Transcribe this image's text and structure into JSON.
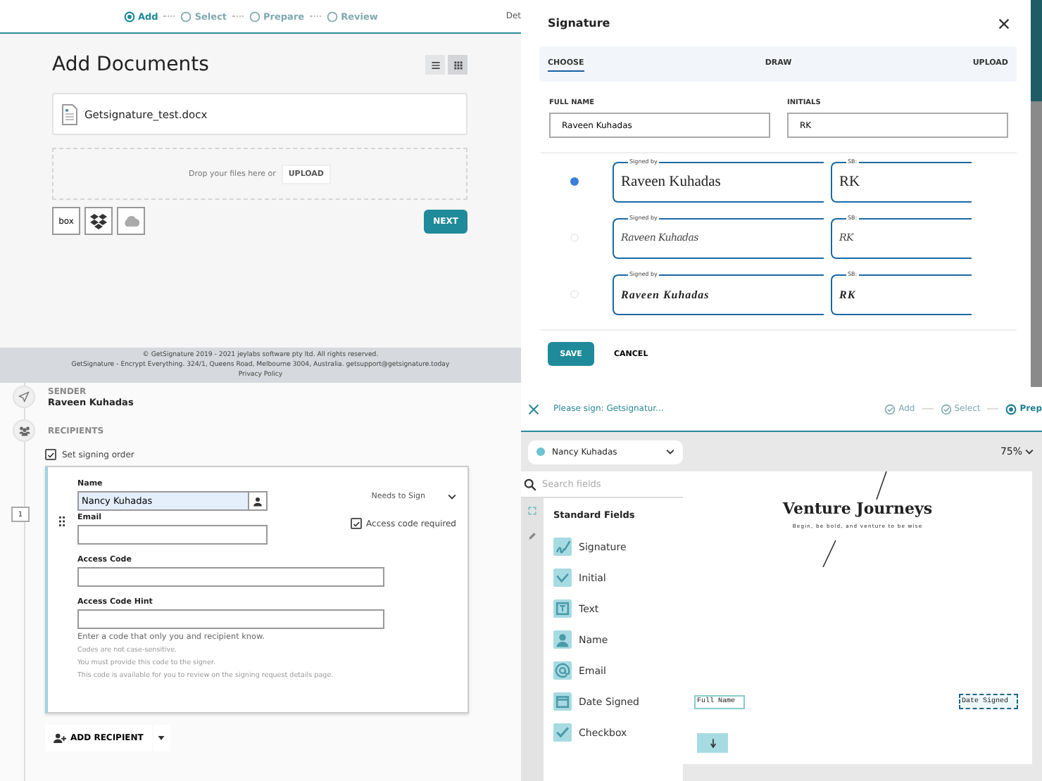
{
  "add_documents": {
    "steps": [
      {
        "label": "Add",
        "selected": true
      },
      {
        "label": "Select",
        "selected": false
      },
      {
        "label": "Prepare",
        "selected": false
      },
      {
        "label": "Review",
        "selected": false
      }
    ],
    "header_link": "Det",
    "title": "Add Documents",
    "view_buttons": [
      {
        "kind": "list",
        "selected": false
      },
      {
        "kind": "grid",
        "selected": true
      }
    ],
    "files": [
      {
        "name": "Getsignature_test.docx"
      }
    ],
    "dropzone": {
      "text": "Drop your files here or",
      "button": "UPLOAD"
    },
    "sources": [
      {
        "kind": "text",
        "label": "box"
      },
      {
        "kind": "dropbox"
      },
      {
        "kind": "cloud"
      }
    ],
    "next_button": "NEXT",
    "footer": [
      "© GetSignature 2019 - 2021 jeylabs software pty ltd. All rights reserved.",
      "GetSignature - Encrypt Everything. 324/1, Queens Road, Melbourne 3004, Australia. getsupport@getsignature.today"
    ],
    "footer_link": "Privacy Policy"
  },
  "signature_dialog": {
    "title": "Signature",
    "tabs": [
      {
        "label": "CHOOSE",
        "selected": true
      },
      {
        "label": "DRAW",
        "selected": false
      },
      {
        "label": "UPLOAD",
        "selected": false
      }
    ],
    "fields": [
      {
        "label": "FULL NAME",
        "value": "Raveen Kuhadas"
      },
      {
        "label": "INITIALS",
        "value": "RK"
      }
    ],
    "options": [
      {
        "selected": true,
        "kind": "print",
        "signed_by": "Signed by",
        "signature": "Raveen Kuhadas",
        "initials_label": "SB:",
        "initials": "RK"
      },
      {
        "selected": false,
        "kind": "script",
        "signed_by": "Signed by",
        "signature": "Raveen Kuhadas",
        "initials_label": "SB:",
        "initials": "RK"
      },
      {
        "selected": false,
        "kind": "bold-script",
        "signed_by": "Signed by",
        "signature": "Raveen Kuhadas",
        "initials_label": "SB:",
        "initials": "RK"
      }
    ],
    "buttons": [
      {
        "kind": "primary",
        "label": "SAVE"
      },
      {
        "kind": "plain",
        "label": "CANCEL"
      }
    ]
  },
  "recipients_form": {
    "sender_label": "SENDER",
    "sender_name": "Raveen Kuhadas",
    "recipients_label": "RECIPIENTS",
    "signing_order": {
      "label": "Set signing order",
      "checked": true
    },
    "recipients": [
      {
        "order": "1",
        "name_label": "Name",
        "name": "Nancy Kuhadas",
        "email_label": "Email",
        "role": "Needs to Sign",
        "access_code_required": {
          "label": "Access code required",
          "checked": true
        },
        "access_code_label": "Access Code",
        "hint_label": "Access Code Hint",
        "help": "Enter a code that only you and recipient know.",
        "notes": [
          "Codes are not case-sensitive.",
          "You must provide this code to the signer.",
          "This code is available for you to review on the signing request details page."
        ]
      }
    ],
    "add_button": "ADD RECIPIENT"
  },
  "prepare": {
    "title": "Please sign: Getsignatur...",
    "steps": [
      {
        "label": "Add",
        "selected": false
      },
      {
        "label": "Select",
        "selected": false
      },
      {
        "label": "Prep",
        "selected": true
      }
    ],
    "recipient": {
      "name": "Nancy Kuhadas",
      "color": "#6cc3d1"
    },
    "zoom": "75%",
    "search": {
      "placeholder": "Search fields"
    },
    "section": "Standard Fields",
    "fields": [
      {
        "kind": "signature",
        "label": "Signature"
      },
      {
        "kind": "initial",
        "label": "Initial"
      },
      {
        "kind": "text",
        "label": "Text"
      },
      {
        "kind": "name",
        "label": "Name"
      },
      {
        "kind": "email",
        "label": "Email"
      },
      {
        "kind": "date",
        "label": "Date Signed"
      },
      {
        "kind": "checkbox",
        "label": "Checkbox"
      }
    ],
    "document": {
      "heading": "Venture Journeys",
      "tagline": "Begin, be bold, and venture to be wise",
      "placed_fields": [
        {
          "kind": "text",
          "label": "Full Name"
        },
        {
          "kind": "date",
          "label": "Date Signed"
        },
        {
          "kind": "signature"
        }
      ]
    }
  }
}
